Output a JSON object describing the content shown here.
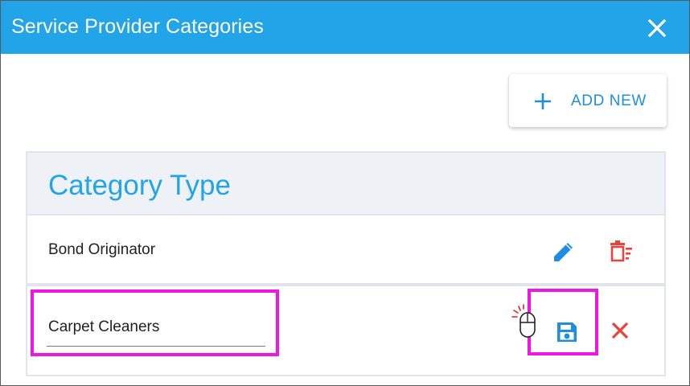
{
  "dialog": {
    "title": "Service Provider Categories",
    "close_icon": "close-icon"
  },
  "toolbar": {
    "add_new_label": "ADD NEW",
    "add_icon": "plus-icon"
  },
  "table": {
    "header": "Category Type",
    "rows": [
      {
        "label": "Bond Originator",
        "actions": [
          "edit-icon",
          "delete-icon"
        ]
      },
      {
        "input_value": "Carpet Cleaners",
        "actions": [
          "save-icon",
          "cancel-icon"
        ]
      }
    ]
  },
  "colors": {
    "titlebar": "#22a4e8",
    "accent": "#1e8ee0",
    "danger": "#e8423b",
    "highlight": "#f016e4"
  }
}
